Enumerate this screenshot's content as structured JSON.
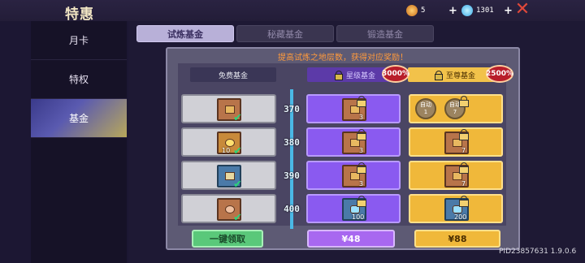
{
  "header": {
    "title": "特惠",
    "currency1": {
      "icon": "fire-coin-icon",
      "value": "5"
    },
    "currency2": {
      "icon": "gem-icon",
      "value": "1301"
    }
  },
  "sidebar": {
    "items": [
      {
        "label": "月卡"
      },
      {
        "label": "特权"
      },
      {
        "label": "基金"
      }
    ]
  },
  "tabs": [
    {
      "label": "试炼基金"
    },
    {
      "label": "秘藏基金"
    },
    {
      "label": "锻造基金"
    }
  ],
  "headline": "提高试炼之地层数，获得对应奖励！",
  "columns": {
    "free": "免费基金",
    "star": "星级基金",
    "supreme": "至尊基金",
    "star_badge": "3000%",
    "supreme_badge": "2500%"
  },
  "rows": [
    {
      "level": "370",
      "free_qty": "",
      "star_qty": "3",
      "sup_left": {
        "line1": "自动",
        "line2": "1"
      },
      "sup_right": {
        "line1": "自动",
        "line2": "7"
      }
    },
    {
      "level": "380",
      "free_qty": "10",
      "star_qty": "3",
      "sup_qty": "7"
    },
    {
      "level": "390",
      "free_qty": "",
      "star_qty": "3",
      "sup_qty": "7"
    },
    {
      "level": "400",
      "free_qty": "",
      "star_qty": "100",
      "sup_qty": "200"
    }
  ],
  "buttons": {
    "claim_all": "一键领取",
    "star_price": "¥48",
    "supreme_price": "¥88"
  },
  "footer": {
    "pid": "PID23857631 1.9.0.6"
  }
}
